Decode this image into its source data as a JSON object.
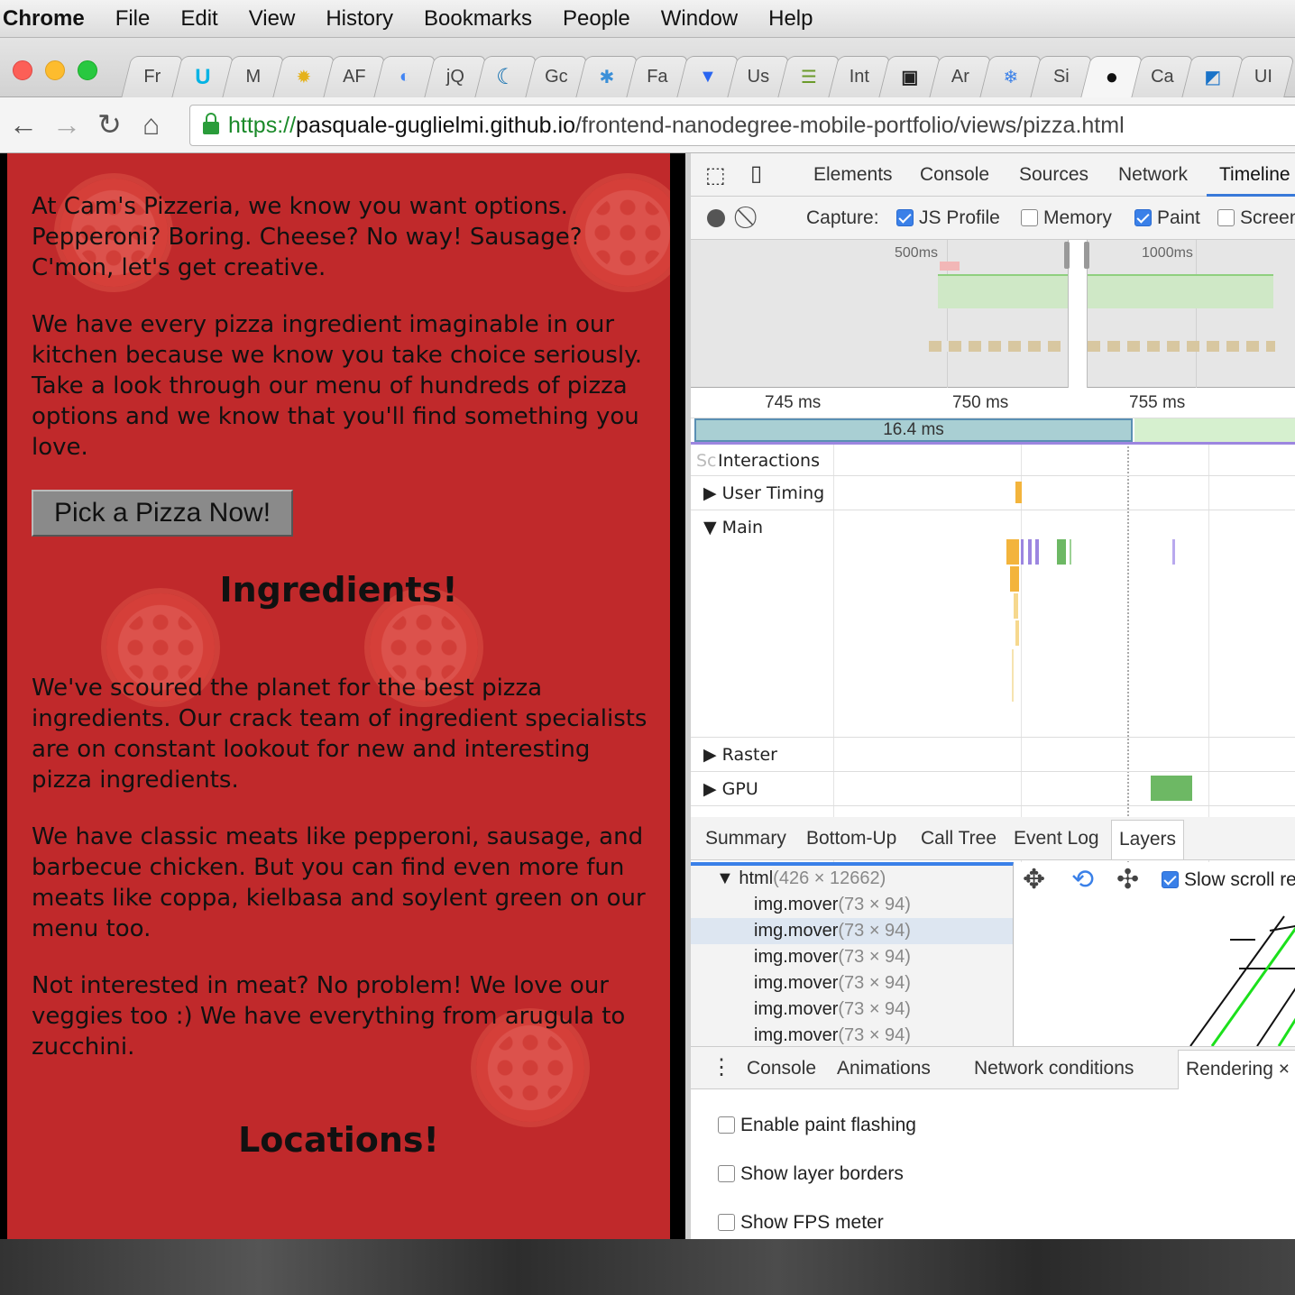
{
  "menubar": {
    "app": "Chrome",
    "items": [
      "File",
      "Edit",
      "View",
      "History",
      "Bookmarks",
      "People",
      "Window",
      "Help"
    ]
  },
  "tabs": [
    "Fr",
    "",
    "M",
    "",
    "AF",
    "",
    "jQ",
    "",
    "Gc",
    "",
    "Fa",
    "",
    "Us",
    "",
    "Int",
    "",
    "Ar",
    "",
    "Si",
    "",
    "Ca",
    "",
    "UI"
  ],
  "address": {
    "scheme": "https://",
    "host": "pasquale-guglielmi.github.io",
    "path": "/frontend-nanodegree-mobile-portfolio/views/pizza.html"
  },
  "page": {
    "para1": "At Cam's Pizzeria, we know you want options. Pepperoni? Boring. Cheese? No way! Sausage? C'mon, let's get creative.",
    "para2": "We have every pizza ingredient imaginable in our kitchen because we know you take choice seriously. Take a look through our menu of hundreds of pizza options and we know that you'll find something you love.",
    "pick_button": "Pick a Pizza Now!",
    "ingredients_heading": "Ingredients!",
    "para3": "We've scoured the planet for the best pizza ingredients. Our crack team of ingredient specialists are on constant lookout for new and interesting pizza ingredients.",
    "para4": "We have classic meats like pepperoni, sausage, and barbecue chicken. But you can find even more fun meats like coppa, kielbasa and soylent green on our menu too.",
    "para5": "Not interested in meat? No problem! We love our veggies too :) We have everything from arugula to zucchini.",
    "locations_heading": "Locations!"
  },
  "devtools": {
    "tabs": [
      "Elements",
      "Console",
      "Sources",
      "Network",
      "Timeline"
    ],
    "active_tab": "Timeline",
    "capture": {
      "label": "Capture:",
      "options": [
        {
          "label": "JS Profile",
          "checked": true
        },
        {
          "label": "Memory",
          "checked": false
        },
        {
          "label": "Paint",
          "checked": true
        },
        {
          "label": "Screen",
          "checked": false
        }
      ]
    },
    "overview_ticks": [
      "500ms",
      "1000ms"
    ],
    "ruler": [
      "745 ms",
      "750 ms",
      "755 ms"
    ],
    "frame_duration": "16.4 ms",
    "tracks": {
      "interactions": "Interactions",
      "interactions_hidden": "Sc",
      "user_timing": "User Timing",
      "main": "Main",
      "raster": "Raster",
      "gpu": "GPU"
    },
    "summary_tabs": [
      "Summary",
      "Bottom-Up",
      "Call Tree",
      "Event Log",
      "Layers"
    ],
    "active_summary_tab": "Layers",
    "layers": {
      "root": {
        "name": "html",
        "size": "(426 × 12662)"
      },
      "items": [
        {
          "name": "img.mover",
          "size": "(73 × 94)"
        },
        {
          "name": "img.mover",
          "size": "(73 × 94)"
        },
        {
          "name": "img.mover",
          "size": "(73 × 94)"
        },
        {
          "name": "img.mover",
          "size": "(73 × 94)"
        },
        {
          "name": "img.mover",
          "size": "(73 × 94)"
        },
        {
          "name": "img.mover",
          "size": "(73 × 94)"
        }
      ],
      "slow_scroll": "Slow scroll re"
    },
    "drawer_tabs": [
      "Console",
      "Animations",
      "Network conditions",
      "Rendering"
    ],
    "active_drawer_tab": "Rendering",
    "rendering_options": [
      "Enable paint flashing",
      "Show layer borders",
      "Show FPS meter"
    ]
  },
  "colors": {
    "page_bg": "#c0292b",
    "accent_blue": "#3a80e8",
    "frame_bar": "#a9cfd3",
    "scripting": "#f3b43c",
    "painting": "#6db864",
    "rendering": "#9c86e0"
  }
}
